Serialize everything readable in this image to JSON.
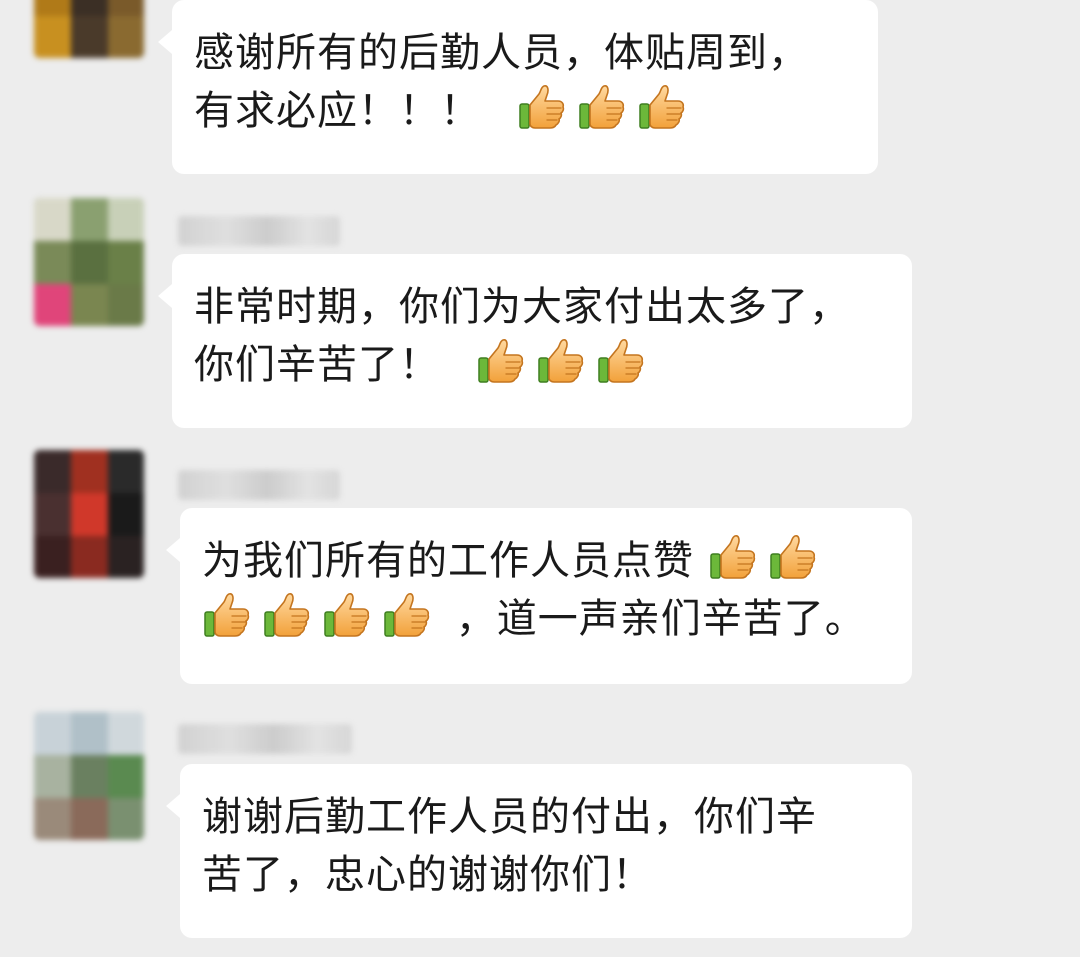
{
  "messages": [
    {
      "lines": [
        {
          "text": "感谢所有的后勤人员，体贴周到，",
          "thumbs": 0
        },
        {
          "text": "有求必应！！！",
          "thumbs": 3,
          "after": ""
        }
      ]
    },
    {
      "lines": [
        {
          "text": "非常时期，你们为大家付出太多了，",
          "thumbs": 0
        },
        {
          "text": "你们辛苦了！",
          "thumbs": 3,
          "after": ""
        }
      ]
    },
    {
      "lines": [
        {
          "text": "为我们所有的工作人员点赞",
          "thumbs": 2,
          "after": ""
        },
        {
          "text": "",
          "thumbs": 4,
          "after": "，道一声亲们辛苦了。"
        }
      ]
    },
    {
      "lines": [
        {
          "text": "谢谢后勤工作人员的付出，你们辛",
          "thumbs": 0
        },
        {
          "text": "苦了，忠心的谢谢你们！",
          "thumbs": 0
        }
      ]
    }
  ],
  "icons": {
    "thumb": "thumbs-up-emoji"
  },
  "colors": {
    "background": "#ededed",
    "bubble": "#ffffff",
    "text": "#1a1a1a"
  }
}
